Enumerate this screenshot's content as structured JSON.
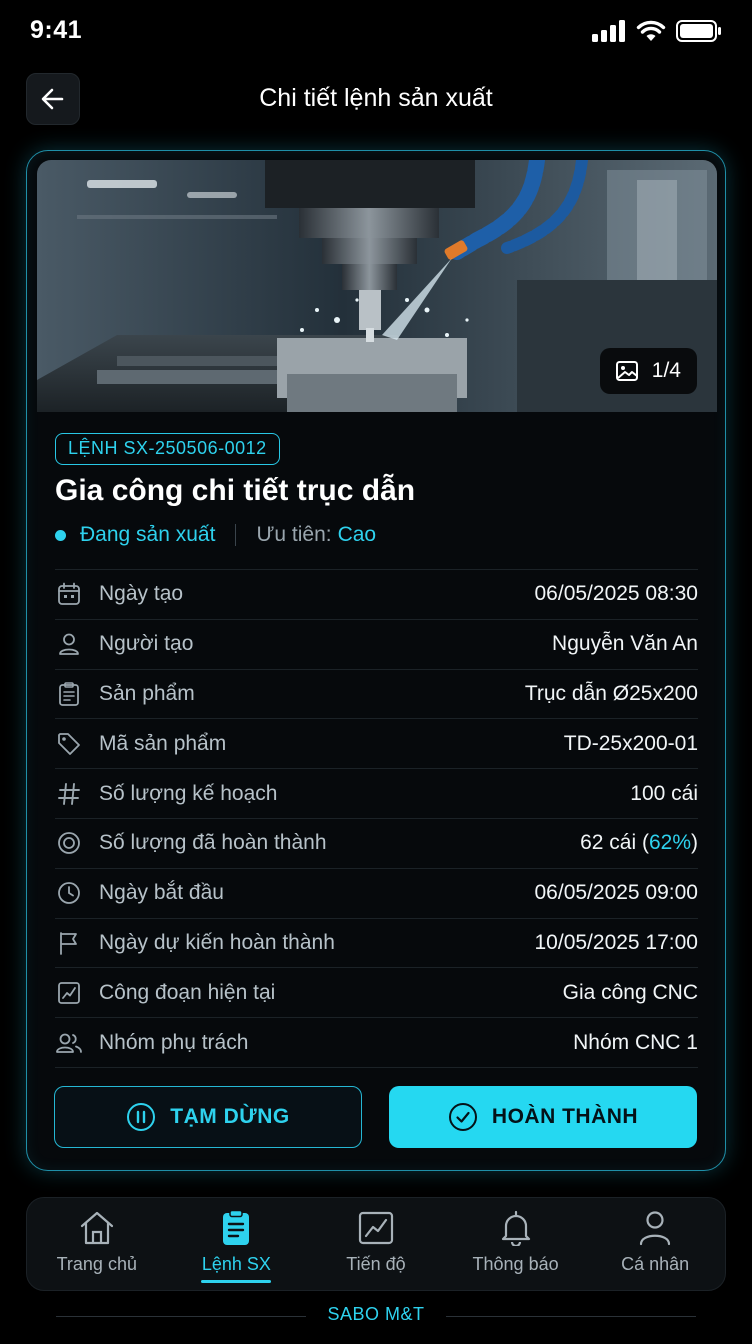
{
  "status_bar": {
    "time": "9:41"
  },
  "header": {
    "title": "Chi tiết lệnh sản xuất"
  },
  "hero": {
    "photo_counter": "1/4"
  },
  "order": {
    "code": "LỆNH SX-250506-0012",
    "title": "Gia công chi tiết trục dẫn",
    "status": "Đang sản xuất",
    "priority_label": "Ưu tiên:",
    "priority_value": "Cao"
  },
  "details": [
    {
      "icon": "calendar-icon",
      "label": "Ngày tạo",
      "value": "06/05/2025 08:30"
    },
    {
      "icon": "user-icon",
      "label": "Người tạo",
      "value": "Nguyễn Văn An"
    },
    {
      "icon": "clipboard-icon",
      "label": "Sản phẩm",
      "value": "Trục dẫn Ø25x200"
    },
    {
      "icon": "tag-icon",
      "label": "Mã sản phẩm",
      "value": "TD-25x200-01"
    },
    {
      "icon": "hash-icon",
      "label": "Số lượng kế hoạch",
      "value": "100 cái"
    },
    {
      "icon": "target-icon",
      "label": "Số lượng đã hoàn thành",
      "value_prefix": "62 cái (",
      "value_accent": "62%",
      "value_suffix": ")"
    },
    {
      "icon": "clock-icon",
      "label": "Ngày bắt đầu",
      "value": "06/05/2025 09:00"
    },
    {
      "icon": "flag-icon",
      "label": "Ngày dự kiến hoàn thành",
      "value": "10/05/2025 17:00"
    },
    {
      "icon": "chart-icon",
      "label": "Công đoạn hiện tại",
      "value": "Gia công CNC"
    },
    {
      "icon": "users-icon",
      "label": "Nhóm phụ trách",
      "value": "Nhóm CNC 1"
    }
  ],
  "actions": {
    "pause_label": "TẠM DỪNG",
    "complete_label": "HOÀN THÀNH"
  },
  "tabs": [
    {
      "icon": "home-icon",
      "label": "Trang chủ",
      "active": false
    },
    {
      "icon": "orders-icon",
      "label": "Lệnh SX",
      "active": true
    },
    {
      "icon": "progress-icon",
      "label": "Tiến độ",
      "active": false
    },
    {
      "icon": "bell-icon",
      "label": "Thông báo",
      "active": false
    },
    {
      "icon": "profile-icon",
      "label": "Cá nhân",
      "active": false
    }
  ],
  "footer": {
    "brand": "SABO M&T"
  },
  "colors": {
    "accent": "#25d8f1",
    "background": "#000000",
    "card": "#06090c"
  }
}
